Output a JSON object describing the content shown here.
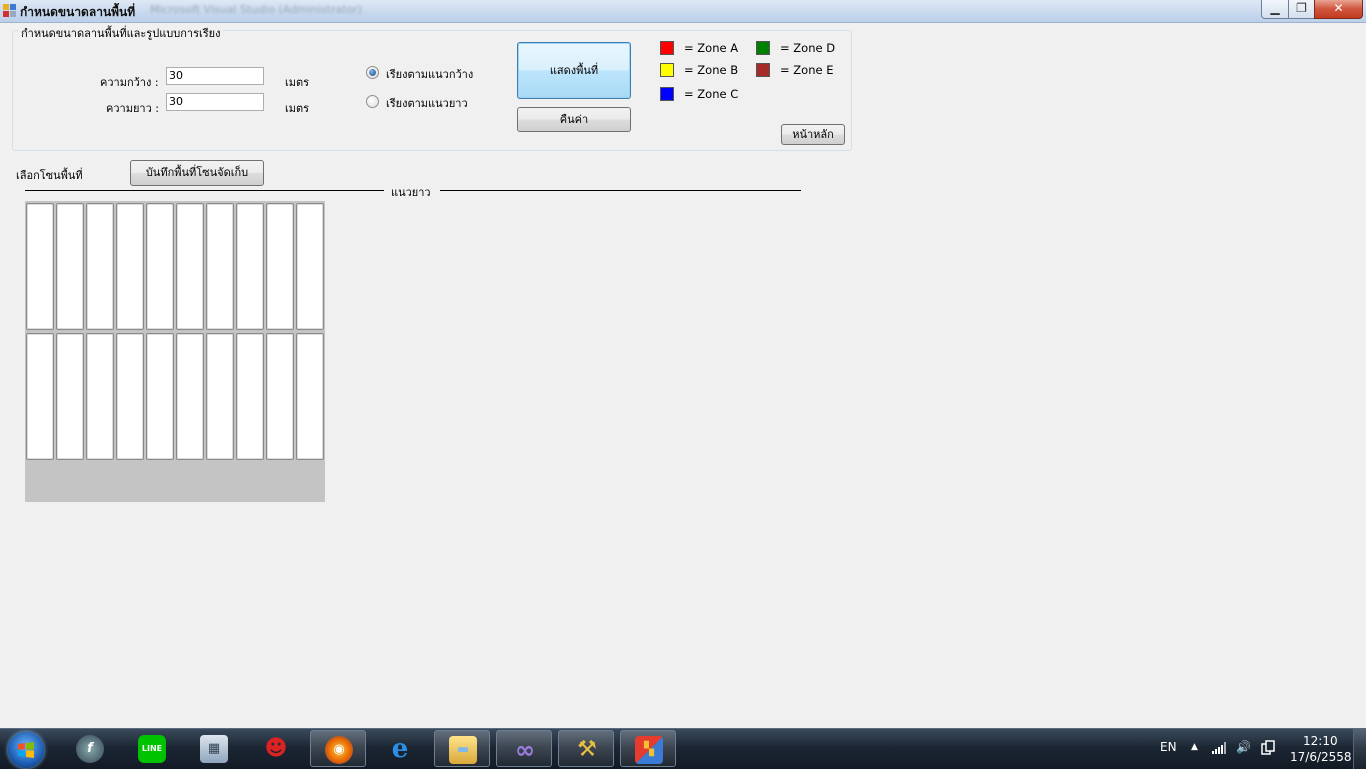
{
  "window": {
    "title": "กำหนดขนาดลานพื้นที่",
    "ghost_title": "Microsoft Visual Studio (Administrator)",
    "minimize_symbol": "▁",
    "maximize_symbol": "❐",
    "close_symbol": "✕"
  },
  "group": {
    "title": "กำหนดขนาดลานพื้นที่และรูปแบบการเรียง",
    "width_label": "ความกว้าง :",
    "width_value": "30",
    "width_unit": "เมตร",
    "length_label": "ความยาว :",
    "length_value": "30",
    "length_unit": "เมตร",
    "radio_width_label": "เรียงตามแนวกว้าง",
    "radio_length_label": "เรียงตามแนวยาว",
    "selected_radio": "width",
    "show_button": "แสดงพื้นที่",
    "reset_button": "คืนค่า",
    "home_button": "หน้าหลัก"
  },
  "legend": [
    {
      "label": "= Zone A",
      "color": "#ff0000"
    },
    {
      "label": "= Zone B",
      "color": "#ffff00"
    },
    {
      "label": "= Zone C",
      "color": "#0000ff"
    },
    {
      "label": "= Zone D",
      "color": "#008000"
    },
    {
      "label": "= Zone E",
      "color": "#a52a2a"
    }
  ],
  "zone_select": {
    "label": "เลือกโซนพื้นที่",
    "save_button": "บันทึกพื้นที่โซนจัดเก็บ",
    "axis_label": "แนวยาว"
  },
  "grid": {
    "rows": 2,
    "columns": 10,
    "cell_color": "#ffffff",
    "background_color": "#c4c4c4"
  },
  "taskbar": {
    "start": "windows-orb-icon",
    "items": [
      {
        "name": "flash-icon",
        "glyph": "f",
        "active": false
      },
      {
        "name": "line-icon",
        "glyph": "LINE",
        "active": false
      },
      {
        "name": "calculator-icon",
        "glyph": "▦",
        "active": false
      },
      {
        "name": "hacker-icon",
        "glyph": "☻",
        "active": false
      },
      {
        "name": "firefox-icon",
        "glyph": "◉",
        "active": true
      },
      {
        "name": "internet-explorer-icon",
        "glyph": "e",
        "active": false
      },
      {
        "name": "file-explorer-icon",
        "glyph": "▬",
        "active": true
      },
      {
        "name": "visual-studio-icon",
        "glyph": "∞",
        "active": true
      },
      {
        "name": "tools-icon",
        "glyph": "⚒",
        "active": true
      },
      {
        "name": "app-form-icon",
        "glyph": "▚",
        "active": true
      }
    ],
    "language": "EN",
    "tray_arrow": "▲",
    "signal": "signal-icon",
    "volume": "🔊",
    "time": "12:10",
    "date": "17/6/2558"
  }
}
